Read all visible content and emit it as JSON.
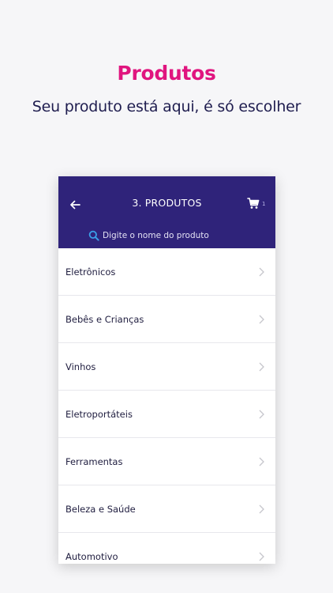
{
  "hero": {
    "title": "Produtos",
    "subtitle": "Seu produto está aqui, é só escolher"
  },
  "appbar": {
    "title": "3. PRODUTOS",
    "cart_count": "1",
    "back_icon": "arrow-left-icon",
    "cart_icon": "cart-icon"
  },
  "search": {
    "placeholder": "Digite o nome do produto",
    "icon": "search-icon"
  },
  "categories": [
    {
      "label": "Eletrônicos"
    },
    {
      "label": "Bebês e Crianças"
    },
    {
      "label": "Vinhos"
    },
    {
      "label": "Eletroportáteis"
    },
    {
      "label": "Ferramentas"
    },
    {
      "label": "Beleza e Saúde"
    },
    {
      "label": "Automotivo"
    }
  ],
  "colors": {
    "accent": "#e0157f",
    "appbar": "#2f237a",
    "text_dark": "#1f1d4f",
    "background": "#f6f6f8",
    "search_icon": "#3aa0e8"
  }
}
